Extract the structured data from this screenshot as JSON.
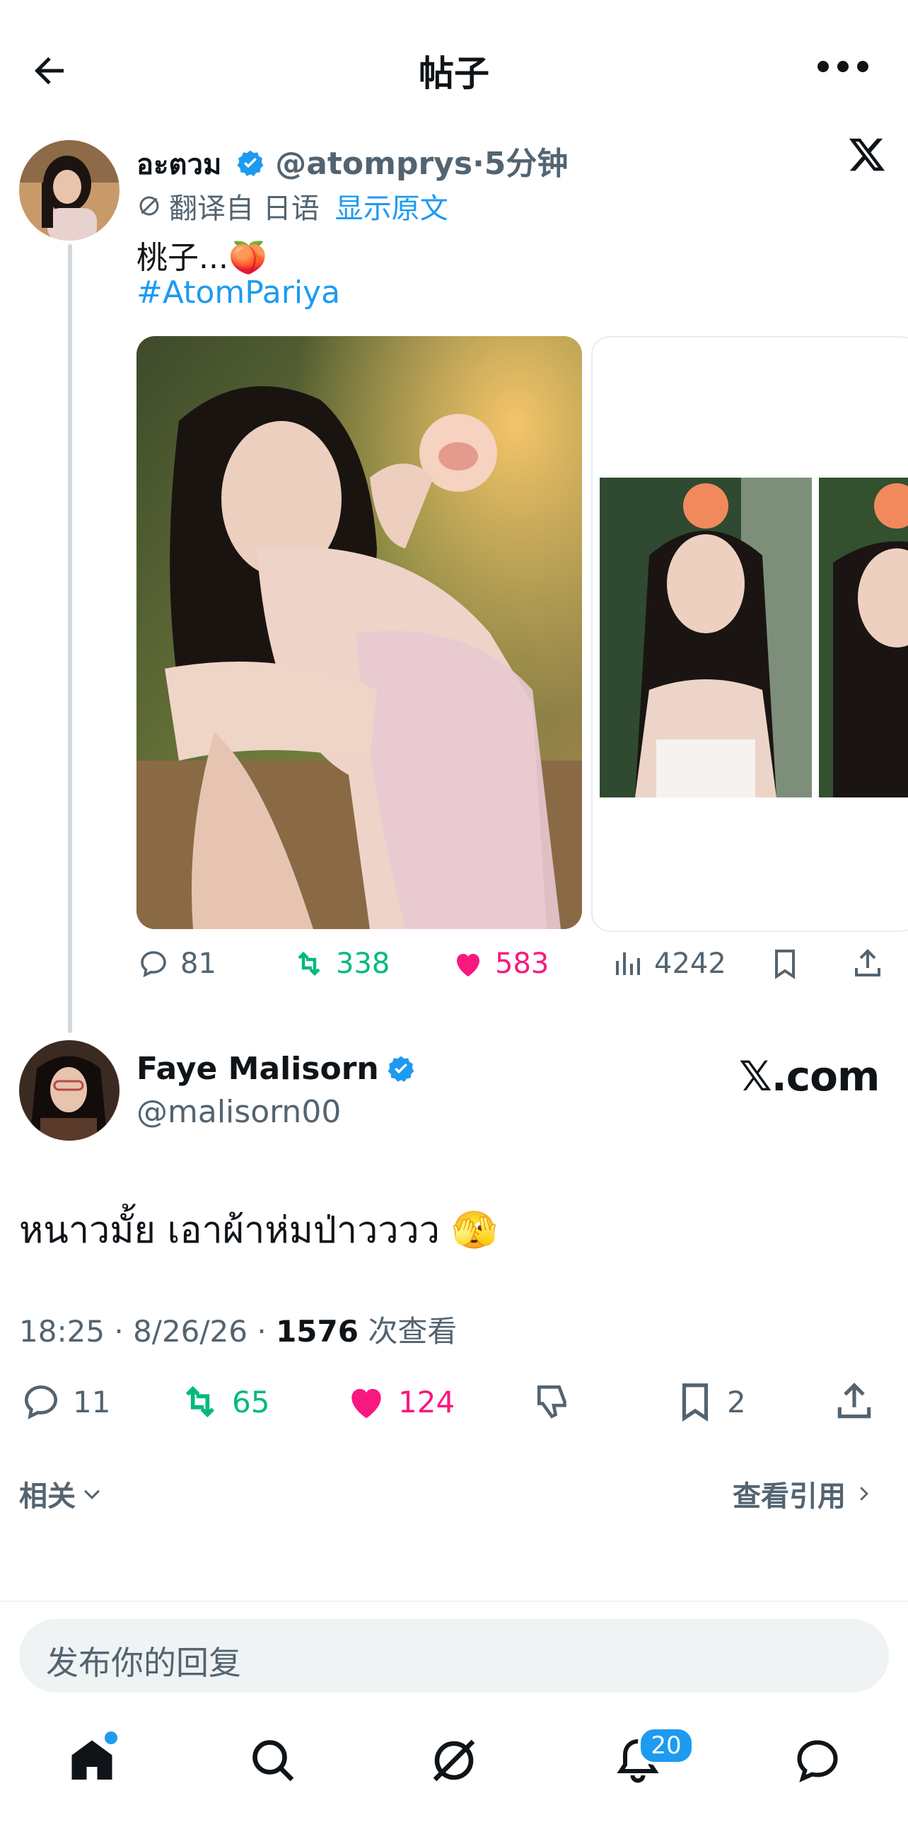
{
  "header": {
    "title": "帖子"
  },
  "parent_tweet": {
    "name": "อะตวม",
    "handle": "@atomprys",
    "time": "·5分钟",
    "translate_label": "翻译自 日语",
    "show_original": "显示原文",
    "text": "桃子...🍑",
    "hashtag": "#AtomPariya",
    "stats": {
      "replies": "81",
      "retweets": "338",
      "likes": "583",
      "views": "4242"
    }
  },
  "main_tweet": {
    "name": "Faye Malisorn",
    "handle": "@malisorn00",
    "watermark": "𝕏.com",
    "text": "หนาวมั้ย เอาผ้าห่มป่าวววว 🫣",
    "time": "18:25 · 8/26/26 · ",
    "views_count": "1576",
    "views_label": " 次查看",
    "stats": {
      "replies": "11",
      "retweets": "65",
      "likes": "124",
      "bookmarks": "2"
    }
  },
  "related_label": "相关",
  "quotes_label": "查看引用",
  "reply_placeholder": "发布你的回复",
  "nav": {
    "notifications_badge": "20"
  },
  "colors": {
    "accent": "#1d9bf0",
    "retweet": "#00ba7c",
    "like": "#f91880",
    "muted": "#536471"
  }
}
